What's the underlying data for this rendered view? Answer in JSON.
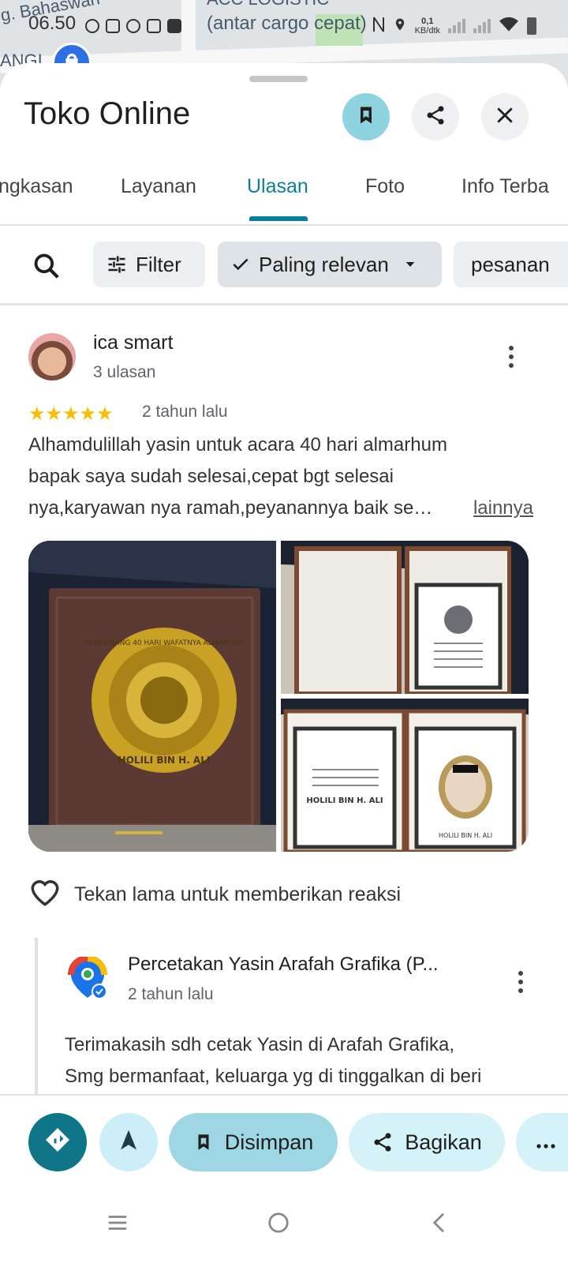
{
  "status_bar": {
    "time": "06.50",
    "net_speed": "0,1",
    "net_unit": "KB/dtk"
  },
  "map": {
    "labels": [
      "g. Bahaswan",
      "ACC LOGISTIC",
      "(antar cargo cepat)",
      "ANGI"
    ]
  },
  "header": {
    "title": "Toko Online"
  },
  "tabs": [
    {
      "label": "ngkasan"
    },
    {
      "label": "Layanan"
    },
    {
      "label": "Ulasan"
    },
    {
      "label": "Foto"
    },
    {
      "label": "Info Terba"
    }
  ],
  "filters": {
    "filter_label": "Filter",
    "sort_label": "Paling relevan",
    "chip3_label": "pesanan"
  },
  "review": {
    "author": "ica smart",
    "review_count": "3 ulasan",
    "rating": 5,
    "stars": "★★★★★",
    "date": "2 tahun lalu",
    "text_line1": "Alhamdulillah yasin untuk acara 40 hari almarhum",
    "text_line2": "bapak saya sudah selesai,cepat bgt selesai",
    "text_line3": "nya,karyawan nya ramah,peyanannya baik se…",
    "more_link": "lainnya",
    "photo1_text_top": "MENGENANG 40 HARI WAFATNYA ALMARHUM",
    "photo1_text_bottom": "HOLILI BIN H. ALI",
    "photo3_text_left": "HOLILI BIN H. ALI",
    "photo3_text_right": "HOLILI BIN H. ALI",
    "react_hint": "Tekan lama untuk memberikan reaksi"
  },
  "owner_reply": {
    "name": "Percetakan Yasin Arafah Grafika (P...",
    "date": "2 tahun lalu",
    "text_line1": "Terimakasih sdh cetak Yasin  di Arafah Grafika,",
    "text_line2": "Smg bermanfaat, keluarga yg di tinggalkan di beri"
  },
  "bottom_bar": {
    "saved_label": "Disimpan",
    "share_label": "Bagikan"
  },
  "colors": {
    "accent": "#0b7ea0",
    "star": "#fbbc04",
    "saved_pill": "#9fd6e3",
    "direction": "#0f7689"
  }
}
